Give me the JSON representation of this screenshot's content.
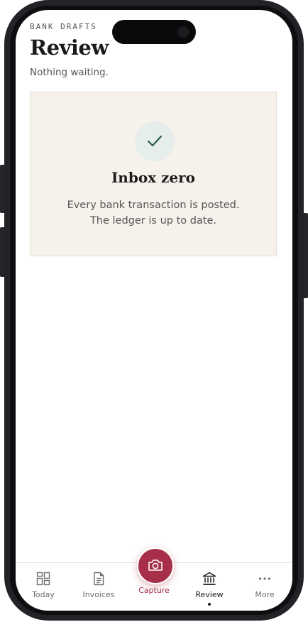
{
  "header": {
    "eyebrow": "BANK DRAFTS",
    "title": "Review",
    "subtitle": "Nothing waiting."
  },
  "empty_state": {
    "icon": "check-icon",
    "title": "Inbox zero",
    "line1": "Every bank transaction is posted.",
    "line2": "The ledger is up to date."
  },
  "tabbar": {
    "items": [
      {
        "label": "Today",
        "icon": "grid-icon"
      },
      {
        "label": "Invoices",
        "icon": "document-icon"
      },
      {
        "label": "Capture",
        "icon": "camera-icon"
      },
      {
        "label": "Review",
        "icon": "bank-icon",
        "active": true
      },
      {
        "label": "More",
        "icon": "more-icon"
      }
    ]
  },
  "colors": {
    "accent": "#a82f49",
    "card_bg": "#f6f2eb",
    "check_bg": "#e5eeea",
    "check": "#2f5a48"
  }
}
